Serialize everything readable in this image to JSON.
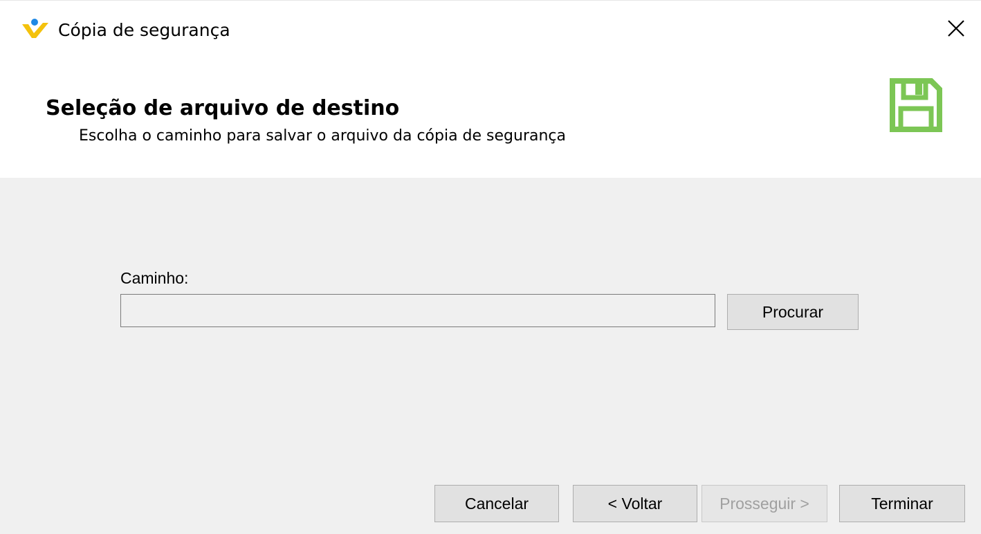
{
  "window": {
    "title": "Cópia de segurança",
    "app_icon": "app-logo-icon",
    "close_icon": "close-icon"
  },
  "header": {
    "title": "Seleção de arquivo de destino",
    "subtitle": "Escolha o caminho para salvar o arquivo da cópia de segurança",
    "icon": "floppy-disk-icon",
    "icon_color": "#7cc655"
  },
  "form": {
    "path_label": "Caminho:",
    "path_value": "",
    "browse_label": "Procurar"
  },
  "footer": {
    "cancel_label": "Cancelar",
    "back_label": "< Voltar",
    "next_label": "Prosseguir >",
    "finish_label": "Terminar"
  },
  "colors": {
    "logo_yellow": "#f4c20d",
    "logo_blue": "#1e88e5",
    "panel_bg": "#f0f0f0",
    "button_bg": "#e1e1e1"
  }
}
